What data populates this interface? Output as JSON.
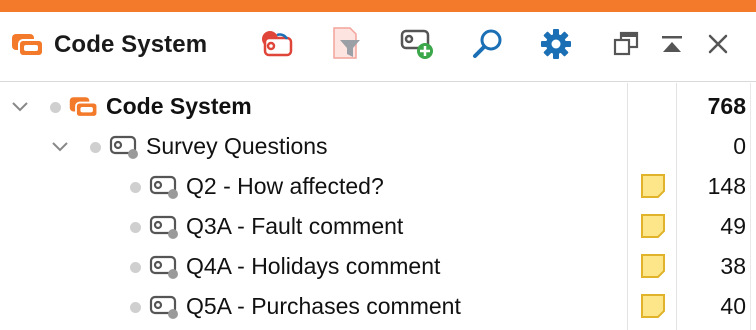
{
  "window": {
    "title": "Code System",
    "accent_color": "#f47a2b"
  },
  "toolbar": {
    "buttons": [
      {
        "name": "activate-codes-icon",
        "tooltip": "Activate codes"
      },
      {
        "name": "filter-codes-icon",
        "tooltip": "Filter codes"
      },
      {
        "name": "new-code-icon",
        "tooltip": "New code"
      },
      {
        "name": "search-icon",
        "tooltip": "Search"
      },
      {
        "name": "settings-icon",
        "tooltip": "Settings"
      },
      {
        "name": "undock-icon",
        "tooltip": "Undock window"
      },
      {
        "name": "collapse-icon",
        "tooltip": "Collapse"
      },
      {
        "name": "close-icon",
        "tooltip": "Close"
      }
    ]
  },
  "tree": {
    "root": {
      "label": "Code System",
      "count": "768"
    },
    "group": {
      "label": "Survey Questions",
      "count": "0"
    },
    "codes": [
      {
        "label": "Q2 - How affected?",
        "count": "148",
        "has_memo": true
      },
      {
        "label": "Q3A - Fault comment",
        "count": "49",
        "has_memo": true
      },
      {
        "label": "Q4A - Holidays comment",
        "count": "38",
        "has_memo": true
      },
      {
        "label": "Q5A - Purchases comment",
        "count": "40",
        "has_memo": true
      }
    ]
  },
  "colors": {
    "code_system_icon": "#f47a2b",
    "memo_fill": "#fde68a",
    "memo_stroke": "#e0b32b",
    "icon_blue": "#1a6fb5",
    "icon_green": "#3ca64a",
    "icon_red": "#e0453a"
  }
}
